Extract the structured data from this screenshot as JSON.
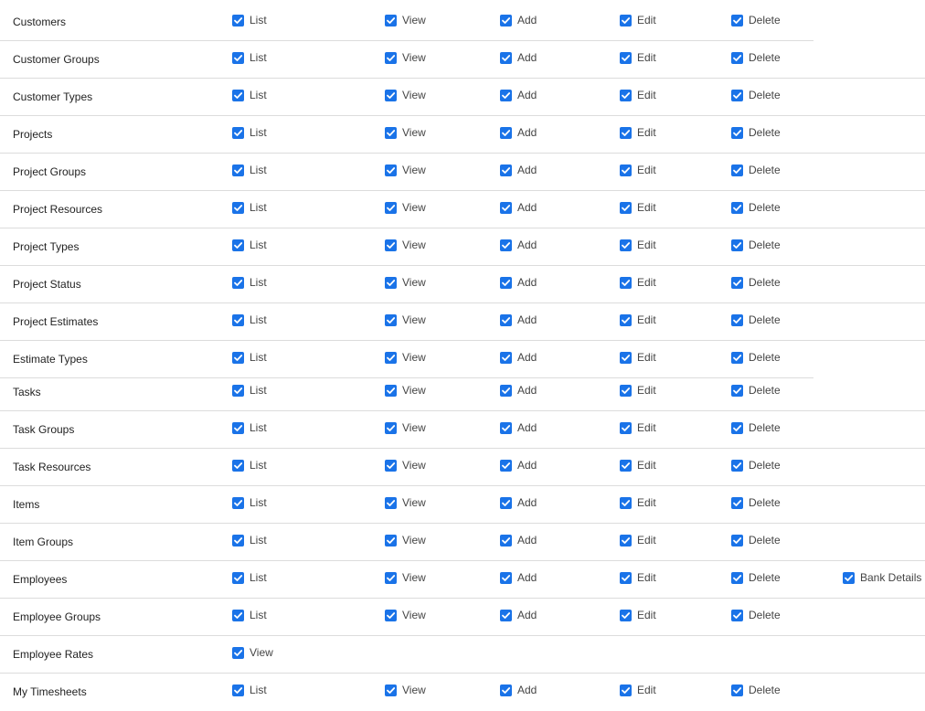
{
  "accent_color": "#1a73e8",
  "check_icon": "checkmark-icon",
  "rows": [
    {
      "label": "Customers",
      "perms": [
        "List",
        "View",
        "Add",
        "Edit",
        "Delete"
      ]
    },
    {
      "label": "Customer Groups",
      "perms": [
        "List",
        "View",
        "Add",
        "Edit",
        "Delete"
      ]
    },
    {
      "label": "Customer Types",
      "perms": [
        "List",
        "View",
        "Add",
        "Edit",
        "Delete"
      ]
    },
    {
      "label": "Projects",
      "perms": [
        "List",
        "View",
        "Add",
        "Edit",
        "Delete"
      ]
    },
    {
      "label": "Project Groups",
      "perms": [
        "List",
        "View",
        "Add",
        "Edit",
        "Delete"
      ]
    },
    {
      "label": "Project Resources",
      "perms": [
        "List",
        "View",
        "Add",
        "Edit",
        "Delete"
      ]
    },
    {
      "label": "Project Types",
      "perms": [
        "List",
        "View",
        "Add",
        "Edit",
        "Delete"
      ]
    },
    {
      "label": "Project Status",
      "perms": [
        "List",
        "View",
        "Add",
        "Edit",
        "Delete"
      ]
    },
    {
      "label": "Project Estimates",
      "perms": [
        "List",
        "View",
        "Add",
        "Edit",
        "Delete"
      ]
    },
    {
      "label": "Estimate Types",
      "perms": [
        "List",
        "View",
        "Add",
        "Edit",
        "Delete"
      ]
    },
    {
      "label": "Tasks",
      "perms": [
        "List",
        "View",
        "Add",
        "Edit",
        "Delete"
      ]
    },
    {
      "label": "Task Groups",
      "perms": [
        "List",
        "View",
        "Add",
        "Edit",
        "Delete"
      ]
    },
    {
      "label": "Task Resources",
      "perms": [
        "List",
        "View",
        "Add",
        "Edit",
        "Delete"
      ]
    },
    {
      "label": "Items",
      "perms": [
        "List",
        "View",
        "Add",
        "Edit",
        "Delete"
      ]
    },
    {
      "label": "Item Groups",
      "perms": [
        "List",
        "View",
        "Add",
        "Edit",
        "Delete"
      ]
    },
    {
      "label": "Employees",
      "perms": [
        "List",
        "View",
        "Add",
        "Edit",
        "Delete",
        "Bank Details"
      ]
    },
    {
      "label": "Employee Groups",
      "perms": [
        "List",
        "View",
        "Add",
        "Edit",
        "Delete"
      ]
    },
    {
      "label": "Employee Rates",
      "perms": [
        "View"
      ]
    },
    {
      "label": "My Timesheets",
      "perms": [
        "List",
        "View",
        "Add",
        "Edit",
        "Delete"
      ]
    }
  ]
}
